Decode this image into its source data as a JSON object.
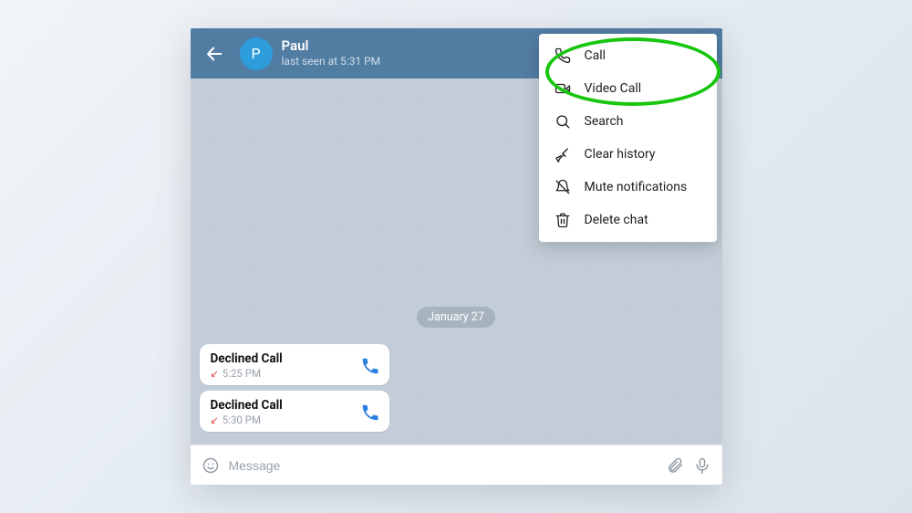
{
  "header": {
    "avatar_initial": "P",
    "contact_name": "Paul",
    "status": "last seen at 5:31 PM"
  },
  "menu": {
    "items": [
      {
        "id": "call",
        "label": "Call"
      },
      {
        "id": "video-call",
        "label": "Video Call"
      },
      {
        "id": "search",
        "label": "Search"
      },
      {
        "id": "clear-history",
        "label": "Clear history"
      },
      {
        "id": "mute-notifications",
        "label": "Mute notifications"
      },
      {
        "id": "delete-chat",
        "label": "Delete chat"
      }
    ]
  },
  "chat": {
    "date_label": "January 27",
    "messages": [
      {
        "type": "call",
        "title": "Declined Call",
        "direction": "incoming-declined",
        "time": "5:25 PM"
      },
      {
        "type": "call",
        "title": "Declined Call",
        "direction": "incoming-declined",
        "time": "5:30 PM"
      }
    ]
  },
  "input": {
    "placeholder": "Message"
  },
  "colors": {
    "header_bg": "#527da3",
    "avatar_bg": "#2e9bdb",
    "chat_bg": "#c3cdd7",
    "call_icon": "#2a80e1",
    "declined_arrow": "#e23b3b",
    "annotation": "#18c60f"
  }
}
